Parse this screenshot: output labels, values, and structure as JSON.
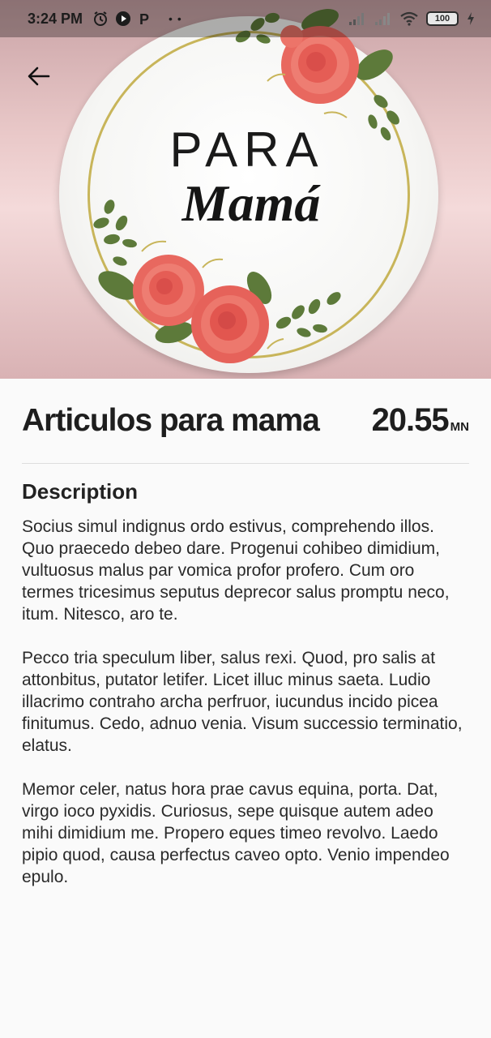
{
  "status_bar": {
    "time": "3:24 PM",
    "battery": "100",
    "icons": [
      "alarm-icon",
      "play-icon",
      "p-badge-icon",
      "signal-icon",
      "signal-icon",
      "wifi-icon",
      "battery-icon",
      "charging-icon"
    ]
  },
  "hero": {
    "logo_top": "PARA",
    "logo_script": "Mamá"
  },
  "product": {
    "title": "Articulos para mama",
    "price": "20.55",
    "currency": "MN"
  },
  "description": {
    "heading": "Description",
    "paragraphs": [
      "Socius simul indignus ordo estivus, comprehendo illos. Quo praecedo debeo dare. Progenui cohibeo dimidium, vultuosus malus par vomica profor profero. Cum oro termes tricesimus seputus deprecor salus promptu neco, itum. Nitesco, aro te.",
      "Pecco tria speculum liber, salus rexi. Quod, pro salis at attonbitus, putator letifer. Licet illuc minus saeta. Ludio illacrimo contraho archa perfruor, iucundus incido picea finitumus. Cedo, adnuo venia. Visum successio terminatio, elatus.",
      "Memor celer, natus hora prae cavus equina, porta. Dat, virgo ioco pyxidis. Curiosus, sepe quisque autem adeo mihi dimidium me. Propero eques timeo revolvo. Laedo pipio quod, causa perfectus caveo opto. Venio impendeo epulo."
    ]
  },
  "colors": {
    "background": "#fafafa",
    "text": "#222222",
    "rose": "#e8685f",
    "leaf": "#5d7a3a",
    "gold": "#c8b55a"
  }
}
